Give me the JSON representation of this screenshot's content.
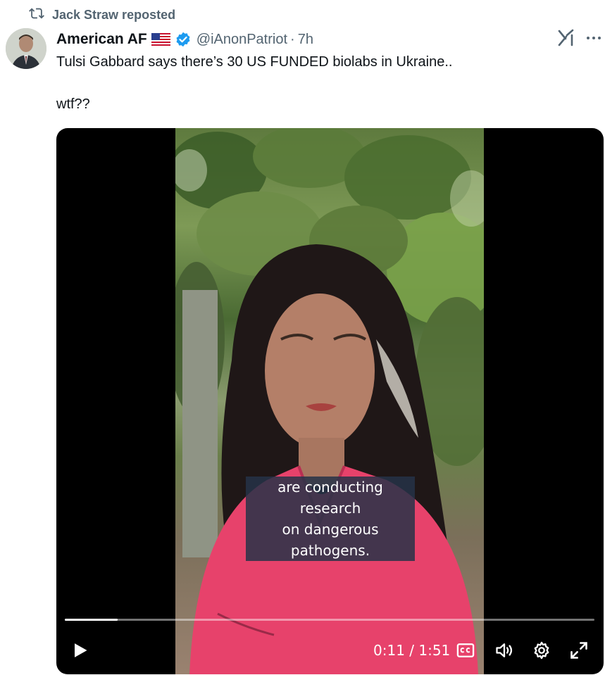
{
  "repost": {
    "label": "Jack Straw reposted",
    "icon": "repost-icon"
  },
  "author": {
    "name": "American AF",
    "flag": "us-flag-icon",
    "verified": true,
    "handle": "@iAnonPatriot",
    "separator": "·",
    "time": "7h"
  },
  "post": {
    "line1": "Tulsi Gabbard says there’s 30 US FUNDED biolabs in Ukraine..",
    "line2": "wtf??"
  },
  "video": {
    "caption_line1": "are conducting research",
    "caption_line2": "on dangerous pathogens.",
    "timecode": "0:11 / 1:51",
    "progress": 0.1
  },
  "colors": {
    "verified": "#1d9bf0",
    "secondary_text": "#536471",
    "caption_bg": "#263248"
  }
}
